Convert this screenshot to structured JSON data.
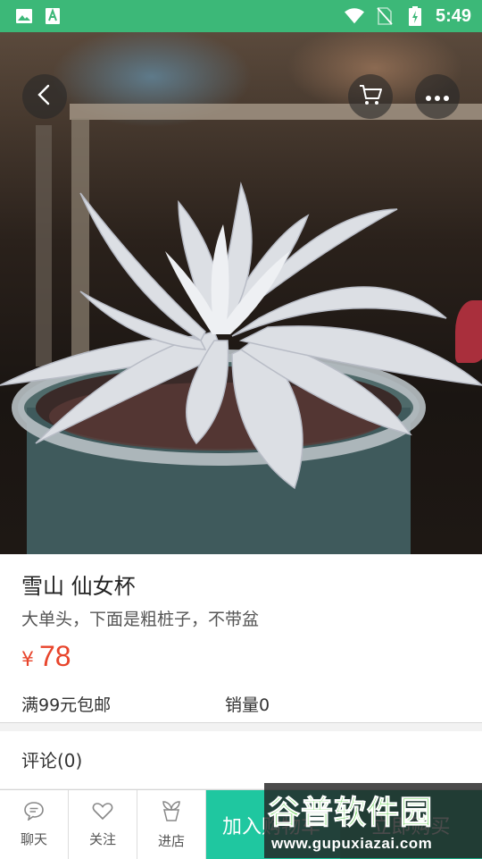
{
  "status_bar": {
    "time": "5:49",
    "left_icons": [
      "image-icon",
      "app-store-icon"
    ],
    "right_icons": [
      "wifi-icon",
      "no-sim-icon",
      "battery-charging-icon"
    ],
    "background": "#3cb878"
  },
  "header": {
    "back_icon": "chevron-left-icon",
    "cart_icon": "cart-icon",
    "more_icon": "more-horizontal-icon"
  },
  "product": {
    "title": "雪山 仙女杯",
    "description": "大单头，下面是粗桩子，不带盆",
    "currency": "¥",
    "price": "78",
    "shipping": "满99元包邮",
    "sales": "销量0",
    "price_color": "#e8452c"
  },
  "comments": {
    "label": "评论(0)"
  },
  "bottom_bar": {
    "chat_label": "聊天",
    "follow_label": "关注",
    "store_label": "进店",
    "add_cart_label": "加入购物车",
    "buy_label": "立即购买",
    "accent": "#1fc7a0"
  },
  "watermark": {
    "title": "谷普软件园",
    "url": "www.gupuxiazai.com"
  }
}
